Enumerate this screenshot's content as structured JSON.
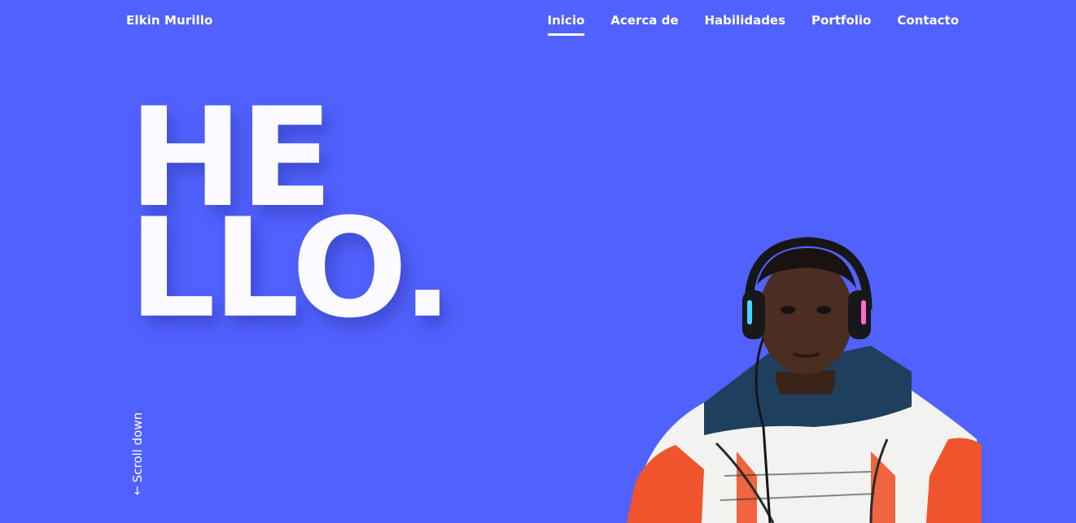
{
  "header": {
    "brand": "Elkin Murillo",
    "nav": [
      {
        "label": "Inicio",
        "active": true
      },
      {
        "label": "Acerca de",
        "active": false
      },
      {
        "label": "Habilidades",
        "active": false
      },
      {
        "label": "Portfolio",
        "active": false
      },
      {
        "label": "Contacto",
        "active": false
      }
    ]
  },
  "hero": {
    "line1": "HE",
    "line2": "LLO.",
    "scroll_label": "Scroll down",
    "scroll_icon": "arrow-down-icon"
  },
  "portrait": {
    "icon": "profile-photo"
  },
  "colors": {
    "background": "#5161fe",
    "text": "#ffffff",
    "hoodie_navy": "#1f3f5e",
    "hoodie_white": "#f2f2f0",
    "hoodie_orange": "#f0542c"
  }
}
